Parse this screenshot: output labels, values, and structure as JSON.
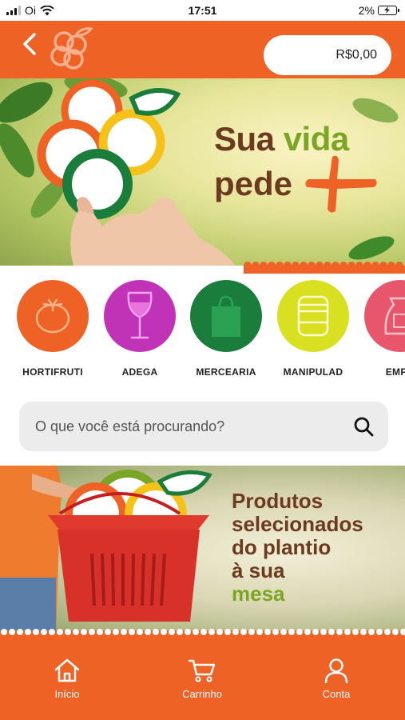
{
  "status_bar": {
    "carrier": "Oi",
    "time": "17:51",
    "battery": "2%"
  },
  "header": {
    "cart_total": "R$0,00"
  },
  "banner1": {
    "line1_a": "Sua ",
    "line1_b": "vida",
    "line2": "pede"
  },
  "categories": [
    {
      "label": "HORTIFRUTI",
      "color": "#ee6226",
      "icon": "tomato-icon"
    },
    {
      "label": "ADEGA",
      "color": "#c033b7",
      "icon": "wine-glass-icon"
    },
    {
      "label": "MERCEARIA",
      "color": "#1a7d3c",
      "icon": "shopping-bag-icon"
    },
    {
      "label": "MANIPULAD",
      "color": "#d9e021",
      "icon": "jar-icon"
    },
    {
      "label": "EMPÓ",
      "color": "#e8566c",
      "icon": "sack-icon"
    }
  ],
  "search": {
    "placeholder": "O que você está procurando?"
  },
  "banner2": {
    "line1": "Produtos",
    "line2": "selecionados",
    "line3": "do plantio",
    "line4_a": "à sua ",
    "line4_b": "mesa"
  },
  "bottom_nav": [
    {
      "label": "Início",
      "icon": "home-icon"
    },
    {
      "label": "Carrinho",
      "icon": "cart-icon"
    },
    {
      "label": "Conta",
      "icon": "user-icon"
    }
  ],
  "colors": {
    "brand_orange": "#ee6226",
    "brand_brown": "#6b3a1f",
    "brand_green": "#7aa525"
  }
}
